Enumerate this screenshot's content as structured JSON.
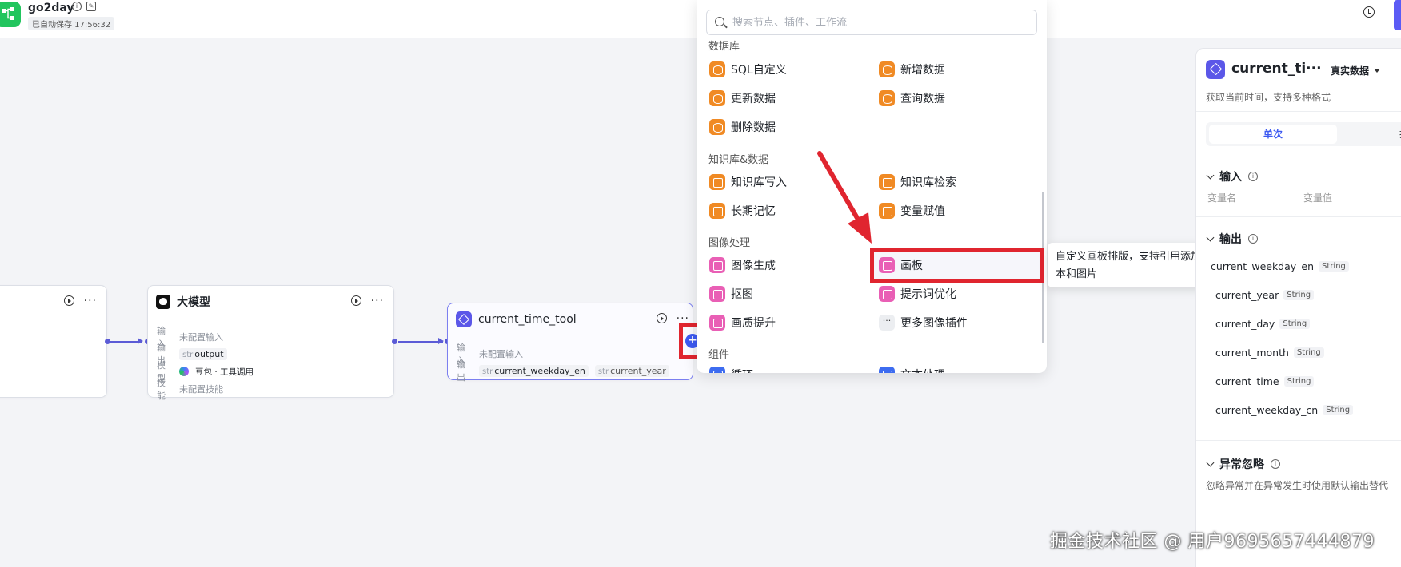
{
  "header": {
    "app_title": "go2day",
    "autosave": "已自动保存 17:56:32"
  },
  "nodes": {
    "llm": {
      "title": "大模型",
      "input_label": "输入",
      "input_value": "未配置输入",
      "output_label": "输出",
      "output_type": "str",
      "output_value": "output",
      "model_label": "模型",
      "model_value": "豆包 · 工具调用",
      "skill_label": "技能",
      "skill_value": "未配置技能"
    },
    "tool": {
      "title": "current_time_tool",
      "input_label": "输入",
      "input_value": "未配置输入",
      "output_label": "输出",
      "output_type": "str",
      "output_1": "current_weekday_en",
      "output_2": "current_year"
    },
    "add_handle": "+"
  },
  "panel": {
    "search_placeholder": "搜索节点、插件、工作流",
    "cat_db": "数据库",
    "db_items": [
      "SQL自定义",
      "新增数据",
      "更新数据",
      "查询数据",
      "删除数据"
    ],
    "cat_kb": "知识库&数据",
    "kb_items": [
      "知识库写入",
      "知识库检索",
      "长期记忆",
      "变量赋值"
    ],
    "cat_img": "图像处理",
    "img_items": [
      "图像生成",
      "画板",
      "抠图",
      "提示词优化",
      "画质提升",
      "更多图像插件"
    ],
    "more_glyph": "···",
    "cat_comp": "组件",
    "comp_items": [
      "循环",
      "文本处理"
    ]
  },
  "tooltip": {
    "text": "自定义画板排版，支持引用添加文本和图片"
  },
  "right_panel": {
    "title": "current_ti···",
    "mode": "真实数据",
    "desc": "获取当前时间，支持多种格式",
    "tab_single": "单次",
    "tab_batch": "批",
    "input_section": "输入",
    "var_name": "变量名",
    "var_value": "变量值",
    "output_section": "输出",
    "outputs": [
      {
        "name": "current_weekday_en",
        "type": "String"
      },
      {
        "name": "current_year",
        "type": "String"
      },
      {
        "name": "current_day",
        "type": "String"
      },
      {
        "name": "current_month",
        "type": "String"
      },
      {
        "name": "current_time",
        "type": "String"
      },
      {
        "name": "current_weekday_cn",
        "type": "String"
      }
    ],
    "exception_section": "异常忽略",
    "exception_desc": "忽略异常并在异常发生时使用默认输出替代"
  },
  "watermark": "掘金技术社区 @ 用户9695657444879",
  "colors": {
    "accent": "#5b5bd6",
    "highlight": "#e0252f",
    "orange_icon": "#f08a24",
    "pink_icon": "#e95fb5"
  }
}
